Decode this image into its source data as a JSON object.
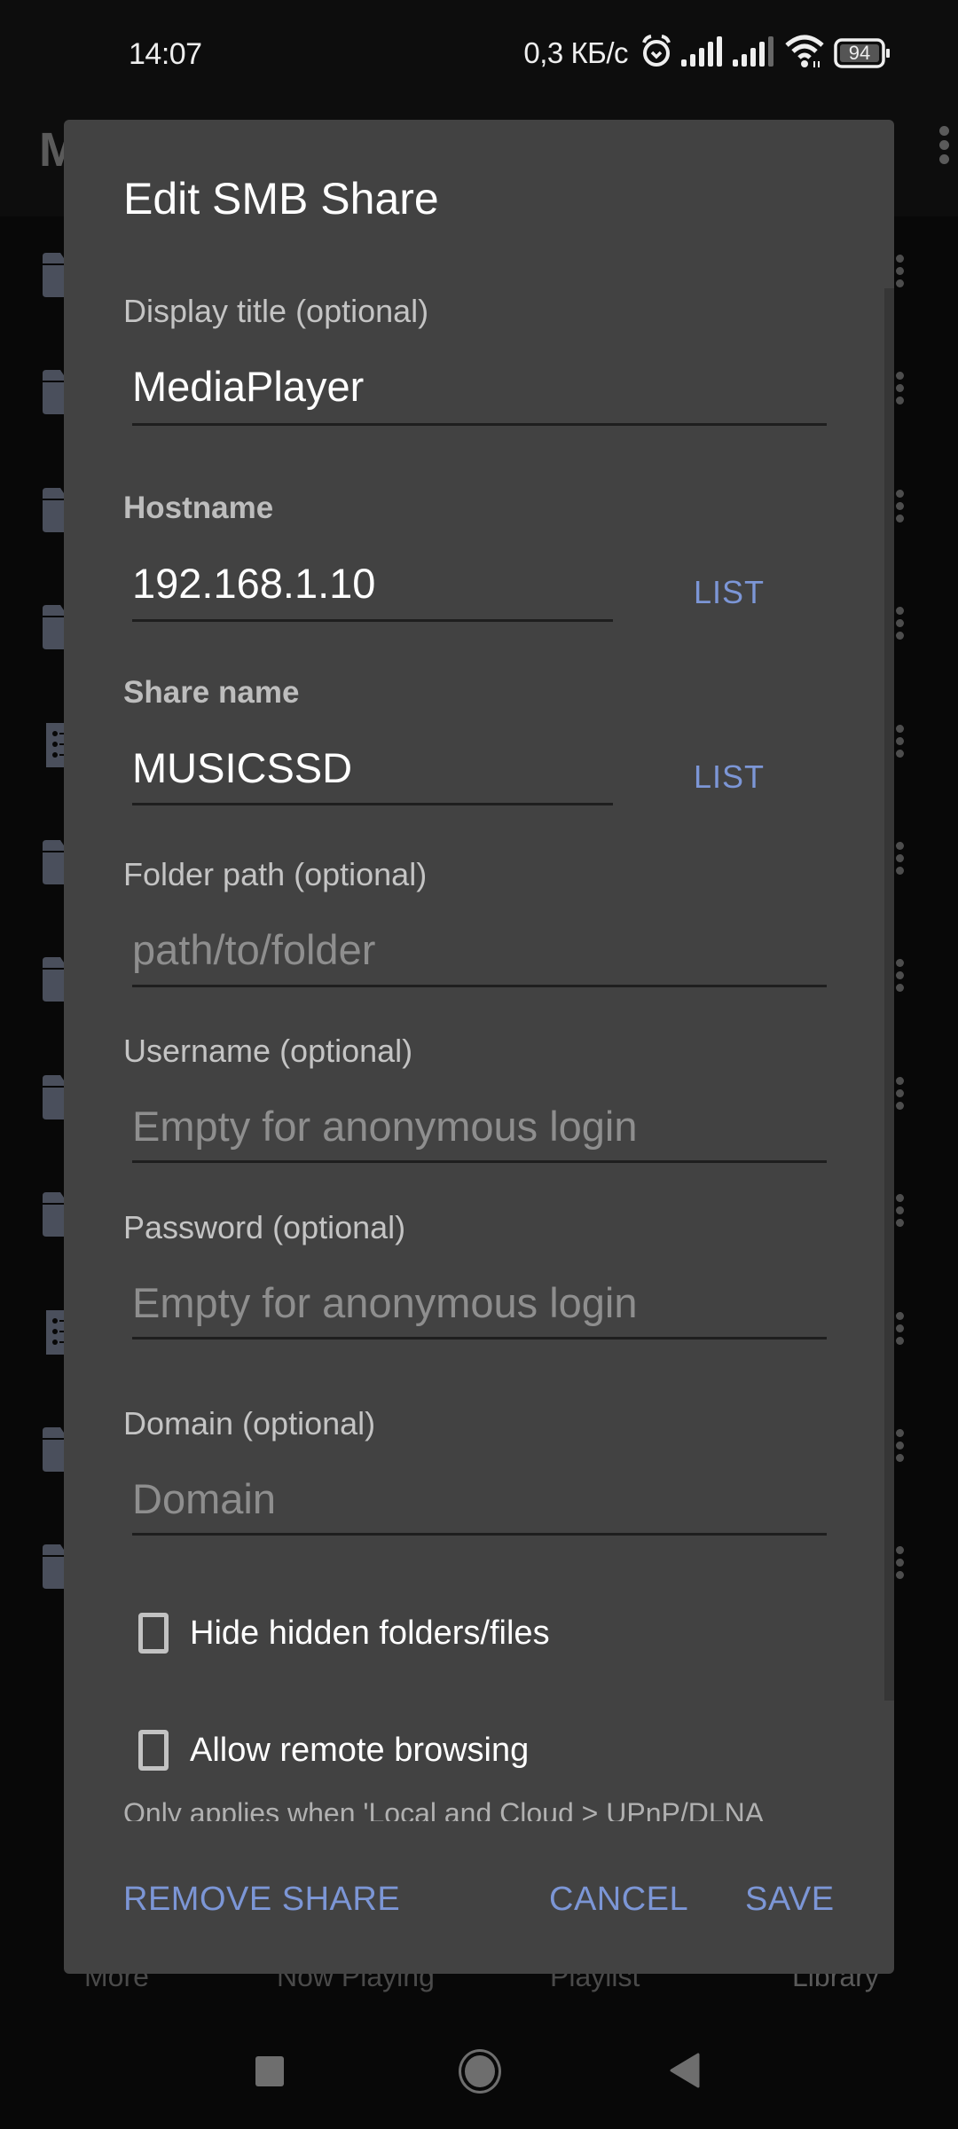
{
  "status_bar": {
    "time": "14:07",
    "network_speed": "0,3 КБ/с",
    "icons": [
      "alarm-icon",
      "signal-sim1-icon",
      "signal-sim2-icon",
      "wifi-icon",
      "battery-icon"
    ],
    "battery_level": "94"
  },
  "background_app": {
    "title_initial": "M",
    "rows": [
      {
        "icon": "folder-icon"
      },
      {
        "icon": "folder-icon"
      },
      {
        "icon": "folder-icon"
      },
      {
        "icon": "folder-icon"
      },
      {
        "icon": "playlist-icon"
      },
      {
        "icon": "folder-icon"
      },
      {
        "icon": "folder-icon"
      },
      {
        "icon": "folder-icon"
      },
      {
        "icon": "folder-icon"
      },
      {
        "icon": "playlist-icon"
      },
      {
        "icon": "folder-icon"
      },
      {
        "icon": "folder-icon"
      }
    ],
    "bottom_nav": [
      "More",
      "Now Playing",
      "Playlist",
      "Library"
    ]
  },
  "dialog": {
    "title": "Edit SMB Share",
    "fields": {
      "display_title": {
        "label": "Display title (optional)",
        "value": "MediaPlayer",
        "placeholder": ""
      },
      "hostname": {
        "label": "Hostname",
        "value": "192.168.1.10",
        "placeholder": "",
        "button": "LIST"
      },
      "share_name": {
        "label": "Share name",
        "value": "MUSICSSD",
        "placeholder": "",
        "button": "LIST"
      },
      "folder_path": {
        "label": "Folder path (optional)",
        "value": "",
        "placeholder": "path/to/folder"
      },
      "username": {
        "label": "Username (optional)",
        "value": "",
        "placeholder": "Empty for anonymous login"
      },
      "password": {
        "label": "Password (optional)",
        "value": "",
        "placeholder": "Empty for anonymous login"
      },
      "domain": {
        "label": "Domain (optional)",
        "value": "",
        "placeholder": "Domain"
      }
    },
    "checkboxes": {
      "hide_hidden": {
        "label": "Hide hidden folders/files",
        "checked": false
      },
      "allow_remote": {
        "label": "Allow remote browsing",
        "checked": false
      }
    },
    "hint": "Only applies when 'Local and Cloud > UPnP/DLNA",
    "actions": {
      "remove": "REMOVE SHARE",
      "cancel": "CANCEL",
      "save": "SAVE"
    },
    "accent_color": "#7c96d6"
  }
}
